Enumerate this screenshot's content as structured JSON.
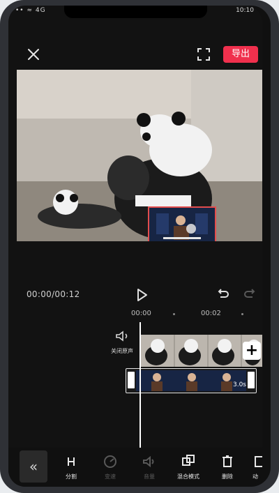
{
  "status": {
    "left_text": "•• ≈ 4G",
    "time": "10:10"
  },
  "topbar": {
    "close_icon": "close-icon",
    "fullscreen_icon": "fullscreen-icon",
    "export_label": "导出",
    "accent_color": "#f0304d"
  },
  "player": {
    "time_readout": "00:00/00:12",
    "play_icon": "play-icon",
    "undo_icon": "undo-icon",
    "redo_icon": "redo-icon"
  },
  "ruler": {
    "labels": [
      "00:00",
      "00:02"
    ]
  },
  "timeline": {
    "mute_label": "关闭原声",
    "clip_duration": "3.0s",
    "add_icon": "+"
  },
  "toolbar": {
    "collapse_icon": "«",
    "tools": [
      {
        "label": "分割",
        "icon": "split-icon",
        "enabled": true
      },
      {
        "label": "变速",
        "icon": "speed-icon",
        "enabled": false
      },
      {
        "label": "音量",
        "icon": "volume-icon",
        "enabled": false
      },
      {
        "label": "混合模式",
        "icon": "blend-mode-icon",
        "enabled": true
      },
      {
        "label": "删除",
        "icon": "delete-icon",
        "enabled": true
      },
      {
        "label": "动",
        "icon": "animation-icon",
        "enabled": true
      }
    ]
  }
}
